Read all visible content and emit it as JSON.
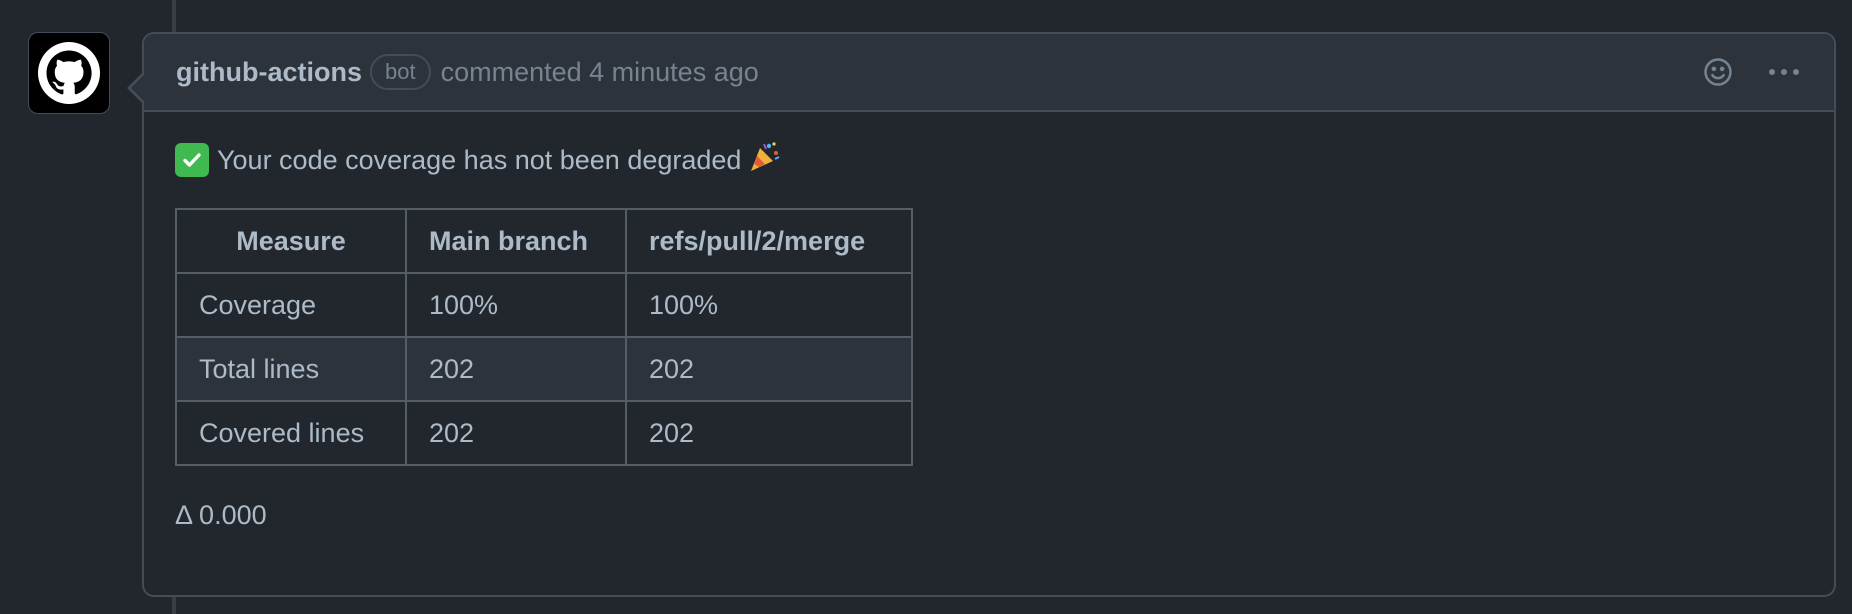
{
  "comment": {
    "author": "github-actions",
    "badge": "bot",
    "meta": "commented 4 minutes ago",
    "actions": {
      "reaction_icon": "smiley-icon",
      "more_icon": "kebab-horizontal-icon"
    },
    "summary_text": "Your code coverage has not been degraded",
    "summary_icons": [
      "check-mark-emoji",
      "party-popper-emoji"
    ],
    "table": {
      "headers": [
        "Measure",
        "Main branch",
        "refs/pull/2/merge"
      ],
      "rows": [
        [
          "Coverage",
          "100%",
          "100%"
        ],
        [
          "Total lines",
          "202",
          "202"
        ],
        [
          "Covered lines",
          "202",
          "202"
        ]
      ]
    },
    "delta": "Δ 0.000"
  },
  "colors": {
    "background": "#22272e",
    "header_background": "#2d333b",
    "border": "#444c56",
    "text": "#adbac7",
    "muted_text": "#768390",
    "check_green": "#3fb950"
  }
}
